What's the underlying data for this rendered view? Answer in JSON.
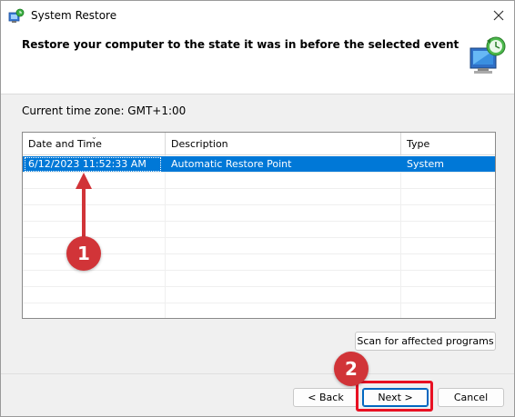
{
  "window": {
    "title": "System Restore",
    "close_icon": "close-icon"
  },
  "header": {
    "title": "Restore your computer to the state it was in before the selected event"
  },
  "timezone_label": "Current time zone: GMT+1:00",
  "table": {
    "columns": [
      "Date and Time",
      "Description",
      "Type"
    ],
    "rows": [
      {
        "date": "6/12/2023 11:52:33 AM",
        "description": "Automatic Restore Point",
        "type": "System",
        "selected": true
      }
    ]
  },
  "buttons": {
    "scan": "Scan for affected programs",
    "back": "< Back",
    "next": "Next >",
    "cancel": "Cancel"
  },
  "annotations": {
    "marker1": "1",
    "marker2": "2"
  },
  "colors": {
    "selection": "#0078d7",
    "marker": "#d13438",
    "highlight": "#e81123"
  }
}
